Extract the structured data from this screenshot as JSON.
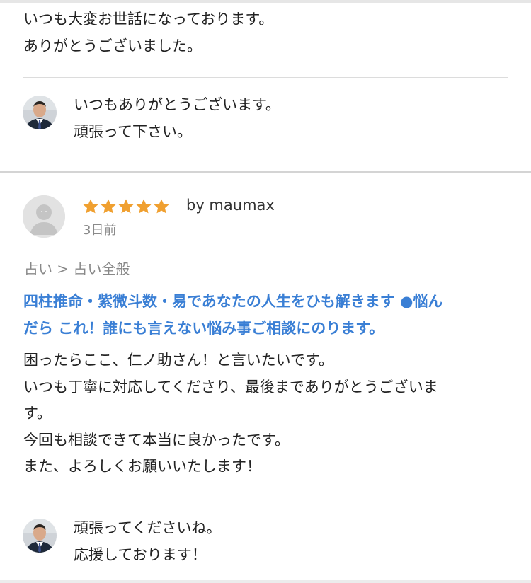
{
  "review_prev": {
    "body_lines": [
      "いつも大変お世話になっております。",
      "ありがとうございました。"
    ],
    "reply_lines": [
      "いつもありがとうございます。",
      "頑張って下さい。"
    ]
  },
  "review": {
    "rating": 5,
    "byline": "by maumax",
    "date": "3日前",
    "category": "占い > 占い全般",
    "service_title_lines": [
      "四柱推命・紫微斗数・易であなたの人生をひも解きます ●悩ん",
      "だら これ！誰にも言えない悩み事ご相談にのります。"
    ],
    "body_lines": [
      "困ったらここ、仁ノ助さん！と言いたいです。",
      "いつも丁寧に対応してくださり、最後までありがとうございま",
      "す。",
      "今回も相談できて本当に良かったです。",
      "また、よろしくお願いいたします！"
    ],
    "reply_lines": [
      "頑張ってくださいね。",
      "応援しております！"
    ]
  },
  "icons": {
    "star": "star-icon",
    "avatar_default": "default-user-avatar",
    "avatar_seller": "seller-photo-avatar"
  },
  "colors": {
    "star": "#f0a030",
    "link": "#3a7fd5",
    "muted": "#888888"
  }
}
